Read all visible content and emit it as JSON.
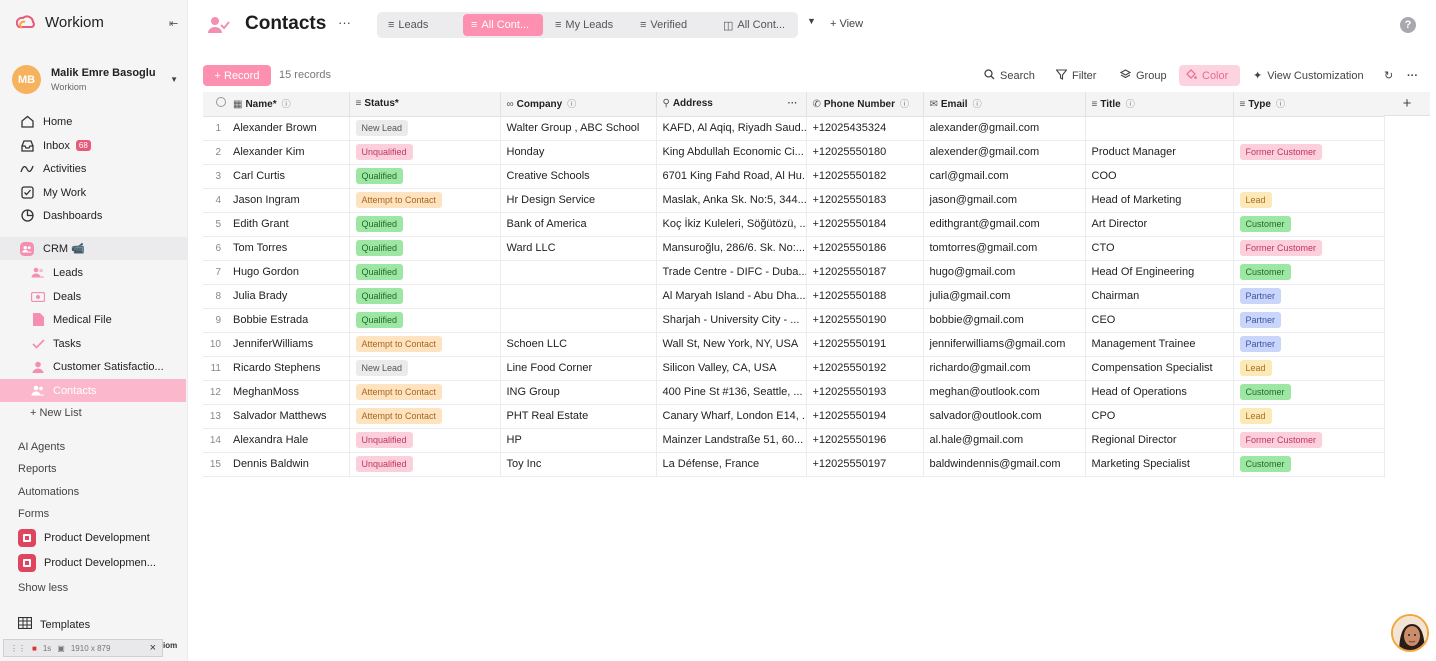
{
  "sidebar": {
    "brand": "Workiom",
    "user": {
      "initials": "MB",
      "name": "Malik Emre Basoglu",
      "workspace": "Workiom"
    },
    "nav": [
      {
        "label": "Home",
        "icon": "home-icon"
      },
      {
        "label": "Inbox",
        "icon": "inbox-icon",
        "badge": "68"
      },
      {
        "label": "Activities",
        "icon": "activity-icon"
      },
      {
        "label": "My Work",
        "icon": "checkbox-icon"
      },
      {
        "label": "Dashboards",
        "icon": "dashboard-icon"
      }
    ],
    "crm_label": "CRM 📹",
    "crm_items": [
      {
        "label": "Leads",
        "icon": "people-icon"
      },
      {
        "label": "Deals",
        "icon": "money-icon"
      },
      {
        "label": "Medical File",
        "icon": "file-icon"
      },
      {
        "label": "Tasks",
        "icon": "check-icon"
      },
      {
        "label": "Customer Satisfactio...",
        "icon": "person-icon"
      },
      {
        "label": "Contacts",
        "icon": "people-icon"
      }
    ],
    "new_list": "+ New List",
    "sections": [
      "AI Agents",
      "Reports",
      "Automations",
      "Forms"
    ],
    "forms": [
      "Product Development",
      "Product Developmen..."
    ],
    "show_less": "Show less",
    "templates": "Templates",
    "devbar": {
      "time": "1s",
      "size": "1910 x 879"
    },
    "watermark": "iom"
  },
  "header": {
    "title": "Contacts",
    "more": "···",
    "tabs": [
      "Leads",
      "All Cont...",
      "My Leads",
      "Verified",
      "All Cont..."
    ],
    "active_tab": 1,
    "add_view": "+ View",
    "help": "?"
  },
  "toolbar": {
    "record": "+ Record",
    "count": "15 records",
    "search": "Search",
    "filter": "Filter",
    "group": "Group",
    "color": "Color",
    "customize": "View Customization"
  },
  "table": {
    "columns": [
      "Name*",
      "Status*",
      "Company",
      "Address",
      "Phone Number",
      "Email",
      "Title",
      "Type"
    ],
    "rows": [
      {
        "num": "1",
        "name": "Alexander Brown",
        "status": "New Lead",
        "company": "Walter Group ,  ABC School",
        "address": "KAFD, Al Aqiq, Riyadh Saud...",
        "phone": "+12025435324",
        "email": "alexander@gmail.com",
        "title": "",
        "type": ""
      },
      {
        "num": "2",
        "name": "Alexander Kim",
        "status": "Unqualified",
        "company": "Honday",
        "address": "King Abdullah Economic Ci...",
        "phone": "+12025550180",
        "email": "alexender@gmail.com",
        "title": "Product Manager",
        "type": "Former Customer"
      },
      {
        "num": "3",
        "name": "Carl Curtis",
        "status": "Qualified",
        "company": "Creative Schools",
        "address": "6701 King Fahd Road, Al Hu...",
        "phone": "+12025550182",
        "email": "carl@gmail.com",
        "title": "COO",
        "type": ""
      },
      {
        "num": "4",
        "name": "Jason Ingram",
        "status": "Attempt to Contact",
        "company": "Hr Design Service",
        "address": "Maslak, Anka Sk. No:5, 344...",
        "phone": "+12025550183",
        "email": "jason@gmail.com",
        "title": "Head of Marketing",
        "type": "Lead"
      },
      {
        "num": "5",
        "name": "Edith Grant",
        "status": "Qualified",
        "company": "Bank of America",
        "address": "Koç İkiz Kuleleri, Söğütözü, ...",
        "phone": "+12025550184",
        "email": "edithgrant@gmail.com",
        "title": "Art Director",
        "type": "Customer"
      },
      {
        "num": "6",
        "name": "Tom Torres",
        "status": "Qualified",
        "company": "Ward LLC",
        "address": "Mansuroğlu, 286/6. Sk. No:...",
        "phone": "+12025550186",
        "email": "tomtorres@gmail.com",
        "title": "CTO",
        "type": "Former Customer"
      },
      {
        "num": "7",
        "name": "Hugo Gordon",
        "status": "Qualified",
        "company": "",
        "address": "Trade Centre - DIFC - Duba...",
        "phone": "+12025550187",
        "email": "hugo@gmail.com",
        "title": "Head Of Engineering",
        "type": "Customer"
      },
      {
        "num": "8",
        "name": "Julia Brady",
        "status": "Qualified",
        "company": "",
        "address": "Al Maryah Island - Abu Dha...",
        "phone": "+12025550188",
        "email": "julia@gmail.com",
        "title": "Chairman",
        "type": "Partner"
      },
      {
        "num": "9",
        "name": "Bobbie Estrada",
        "status": "Qualified",
        "company": "",
        "address": "Sharjah - University City - ...",
        "phone": "+12025550190",
        "email": "bobbie@gmail.com",
        "title": "CEO",
        "type": "Partner"
      },
      {
        "num": "10",
        "name": "JenniferWilliams",
        "status": "Attempt to Contact",
        "company": "Schoen LLC",
        "address": "Wall St, New York, NY, USA",
        "phone": "+12025550191",
        "email": "jenniferwilliams@gmail.com",
        "title": "Management Trainee",
        "type": "Partner"
      },
      {
        "num": "11",
        "name": "Ricardo Stephens",
        "status": "New Lead",
        "company": "Line Food Corner",
        "address": "Silicon Valley, CA, USA",
        "phone": "+12025550192",
        "email": "richardo@gmail.com",
        "title": "Compensation Specialist",
        "type": "Lead"
      },
      {
        "num": "12",
        "name": "MeghanMoss",
        "status": "Attempt to Contact",
        "company": "ING Group",
        "address": "400 Pine St #136, Seattle, ...",
        "phone": "+12025550193",
        "email": "meghan@outlook.com",
        "title": "Head of Operations",
        "type": "Customer"
      },
      {
        "num": "13",
        "name": "Salvador Matthews",
        "status": "Attempt to Contact",
        "company": "PHT Real Estate",
        "address": "Canary Wharf, London E14, ...",
        "phone": "+12025550194",
        "email": "salvador@outlook.com",
        "title": "CPO",
        "type": "Lead"
      },
      {
        "num": "14",
        "name": "Alexandra Hale",
        "status": "Unqualified",
        "company": "HP",
        "address": "Mainzer Landstraße 51, 60...",
        "phone": "+12025550196",
        "email": "al.hale@gmail.com",
        "title": "Regional Director",
        "type": "Former Customer"
      },
      {
        "num": "15",
        "name": "Dennis Baldwin",
        "status": "Unqualified",
        "company": "Toy Inc",
        "address": "La Défense, France",
        "phone": "+12025550197",
        "email": "baldwindennis@gmail.com",
        "title": "Marketing Specialist",
        "type": "Customer"
      }
    ]
  },
  "colors": {
    "accent": "#fd8fb1",
    "sidebar_bg": "#f5f5f6",
    "active_nav": "#fbb8cd"
  }
}
